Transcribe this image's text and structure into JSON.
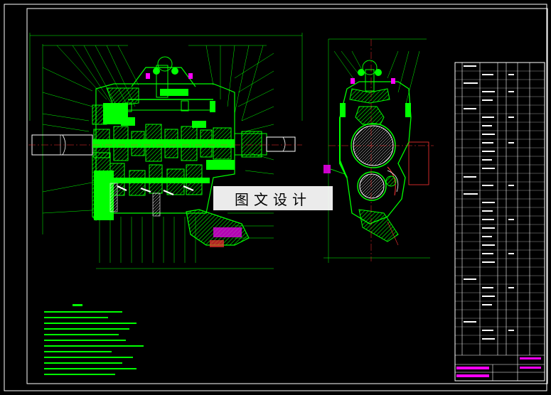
{
  "watermark": {
    "text": "图文设计"
  },
  "colors": {
    "background": "#000000",
    "outline": "#00ff00",
    "frame": "#ffffff",
    "centerline": "#ff3333",
    "parts_highlight": "#ff00ff",
    "section_fill": "#00ff00"
  }
}
